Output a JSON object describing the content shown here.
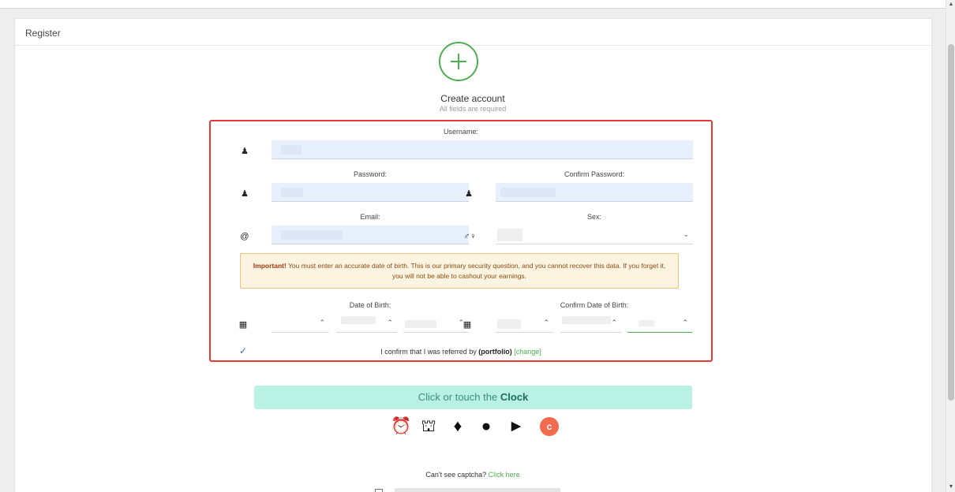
{
  "card": {
    "header": "Register"
  },
  "heading": {
    "title": "Create account",
    "subtitle": "All fields are required"
  },
  "form": {
    "username": {
      "label": "Username:"
    },
    "password": {
      "label": "Password:"
    },
    "confirm_password": {
      "label": "Confirm Password:"
    },
    "email": {
      "label": "Email:"
    },
    "sex": {
      "label": "Sex:"
    },
    "notice": {
      "strong": "Important!",
      "text": " You must enter an accurate date of birth. This is our primary security question, and you cannot recover this data. If you forget it, you will not be able to cashout your earnings."
    },
    "dob": {
      "label": "Date of Birth:"
    },
    "confirm_dob": {
      "label": "Confirm Date of Birth:"
    },
    "referral": {
      "prefix": "I confirm that I was referred by ",
      "referrer": "(portfolio)",
      "change_link": "[change]"
    }
  },
  "captcha": {
    "button_prefix": "Click or touch the ",
    "button_target": "Clock",
    "icons": [
      "alarm-clock-icon",
      "boot-icon",
      "tree-icon",
      "ping-pong-icon",
      "rat-icon"
    ],
    "refresh_symbol": "c"
  },
  "cant_see": {
    "text": "Can't see captcha? ",
    "link": "Click here"
  },
  "colors": {
    "accent_green": "#4caf50",
    "highlight_red": "#e53935",
    "captcha_bg": "#b9f1e4",
    "refresh_orange": "#f26b4f"
  }
}
